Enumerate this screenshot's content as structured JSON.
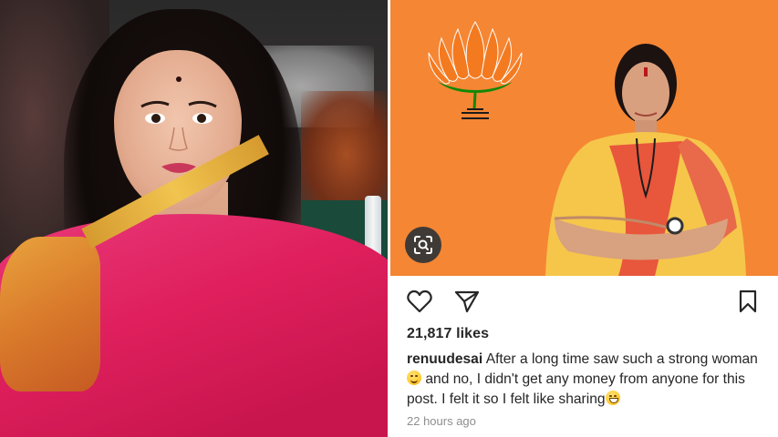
{
  "post": {
    "likes": "21,817 likes",
    "username": "renuudesai",
    "caption_part1": "After a long time saw such a strong woman",
    "caption_part2": "and no, I didn't get any money from anyone for this post. I felt it so I felt like sharing",
    "emoji_1": "smiling-face-emoji",
    "emoji_2": "grinning-face-emoji",
    "timestamp": "22 hours ago"
  },
  "icons": {
    "like": "heart-icon",
    "share": "paper-plane-icon",
    "save": "bookmark-icon",
    "lens": "visual-search-icon",
    "logo": "lotus-logo"
  },
  "colors": {
    "poster_background": "#f58634",
    "text_primary": "#262626",
    "text_secondary": "#8e8e8e",
    "saree_pink": "#e0205e"
  }
}
